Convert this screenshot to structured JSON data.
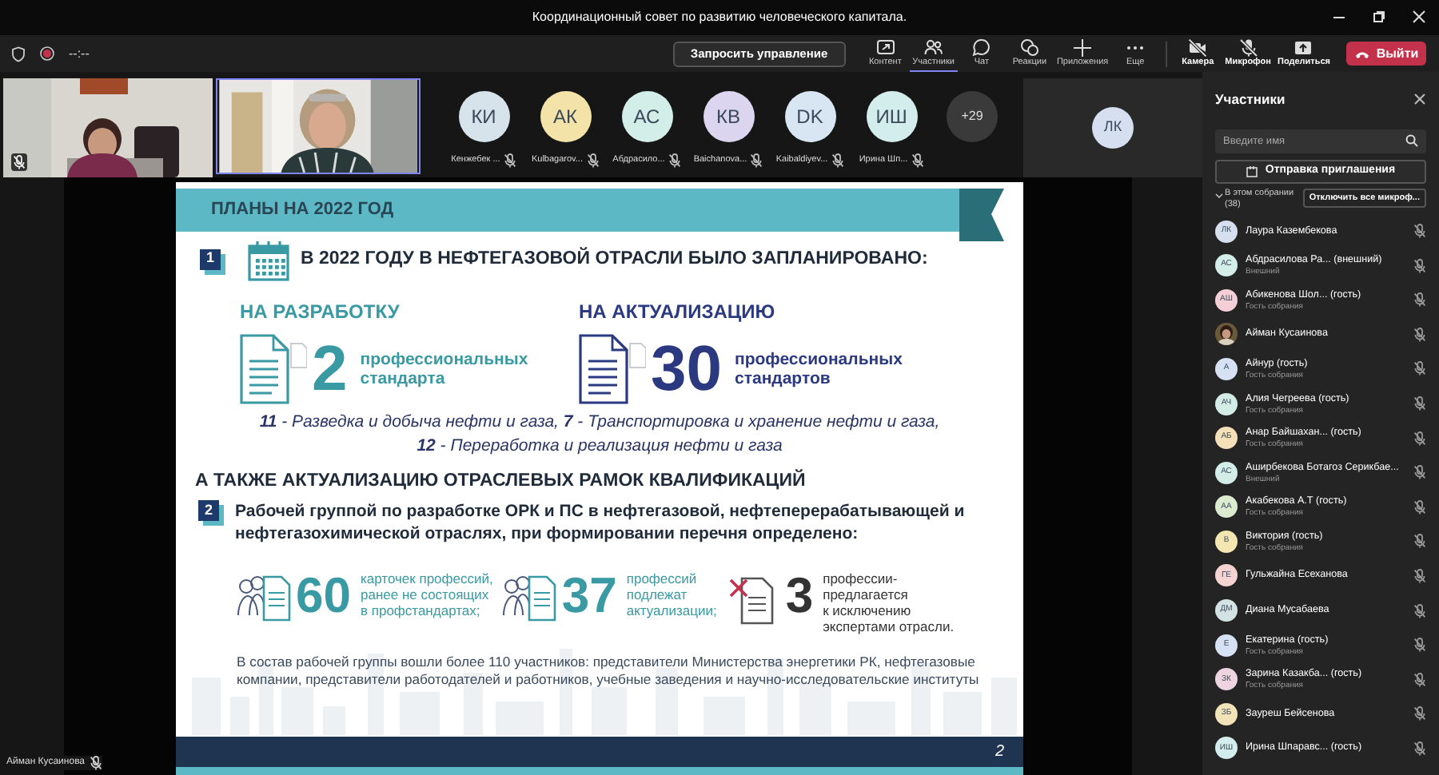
{
  "window": {
    "title": "Координационный совет по развитию человеческого капитала."
  },
  "toolbar": {
    "recording": true,
    "timer": "--:--",
    "request_control": "Запросить управление",
    "buttons": [
      {
        "label": "Контент",
        "kind": "content",
        "selected": false
      },
      {
        "label": "Участники",
        "kind": "people",
        "selected": true
      },
      {
        "label": "Чат",
        "kind": "chat",
        "selected": false
      },
      {
        "label": "Реакции",
        "kind": "reactions",
        "selected": false
      },
      {
        "label": "Приложения",
        "kind": "apps",
        "selected": false
      },
      {
        "label": "Еще",
        "kind": "more",
        "selected": false
      },
      {
        "label": "Камера",
        "kind": "camera-off",
        "selected": false
      },
      {
        "label": "Микрофон",
        "kind": "mic-off",
        "selected": false
      },
      {
        "label": "Поделиться",
        "kind": "share",
        "selected": false
      }
    ],
    "leave": "Выйти"
  },
  "video_tiles": [
    {
      "kind": "picture",
      "speaking": false,
      "muted": true
    },
    {
      "kind": "picture",
      "speaking": true,
      "muted": false
    }
  ],
  "attendees": [
    {
      "initials": "КИ",
      "name": "Кенжебек ...",
      "color": "#d6e3ea"
    },
    {
      "initials": "АК",
      "name": "Kulbagarov...",
      "color": "#f3e3a8"
    },
    {
      "initials": "АС",
      "name": "Абдрасило...",
      "color": "#d3ede8"
    },
    {
      "initials": "КВ",
      "name": "Baichanova...",
      "color": "#dcd5f0"
    },
    {
      "initials": "DK",
      "name": "Kaibaldiyev...",
      "color": "#d7e6f2"
    },
    {
      "initials": "ИШ",
      "name": "Ирина Шп...",
      "color": "#d3ecec"
    }
  ],
  "more_attendees": "+29",
  "pinned": {
    "initials": "ЛК",
    "color": "#d5dff0"
  },
  "stage_label": "Айман Кусаинова",
  "slide": {
    "header": "ПЛАНЫ НА 2022 ГОД",
    "section1": {
      "number": "1",
      "title": "В 2022 ГОДУ В НЕФТЕГАЗОВОЙ ОТРАСЛИ БЫЛО ЗАПЛАНИРОВАНО:",
      "plans": [
        {
          "kind": "teal",
          "heading": "НА РАЗРАБОТКУ",
          "number": "2",
          "text": "профессиональных стандарта"
        },
        {
          "kind": "navy",
          "heading": "НА АКТУАЛИЗАЦИЮ",
          "number": "30",
          "text": "профессиональных стандартов"
        }
      ],
      "details": [
        "**11** - Разведка и добыча нефти и газа, **7** - Транспортировка и хранение нефти и газа,",
        "**12** - Переработка и реализация нефти и газа"
      ]
    },
    "subtitle": "А ТАКЖЕ АКТУАЛИЗАЦИЮ ОТРАСЛЕВЫХ РАМОК КВАЛИФИКАЦИЙ",
    "section2": {
      "number": "2",
      "text": "Рабочей группой по разработке ОРК и ПС в нефтегазовой, нефтеперерабатывающей и нефтегазохимической отраслях, при формировании перечня определено:",
      "stats": [
        {
          "kind": "people",
          "number": "60",
          "lines": [
            "карточек профессий,",
            "ранее не состоящих",
            "в профстандартах;"
          ]
        },
        {
          "kind": "people",
          "number": "37",
          "lines": [
            "профессий",
            "подлежат",
            "актуализации;"
          ]
        },
        {
          "kind": "removed",
          "number": "3",
          "lines": [
            "профессии-",
            "предлагается",
            "к исключению",
            "экспертами отрасли."
          ]
        }
      ]
    },
    "footer": "В состав рабочей группы вошли более 110 участников: представители Министерства энергетики РК, нефтегазовые компании, представители работодателей и работников, учебные заведения и научно-исследовательские институты",
    "page": "2"
  },
  "panel": {
    "title": "Участники",
    "search_placeholder": "Введите имя",
    "invite": "Отправка приглашения",
    "section": "В этом собрании (38)",
    "expanded": true,
    "mute_all": "Отключить все микроф...",
    "people": [
      {
        "initials": "ЛК",
        "name": "Лаура Казембекова",
        "color": "#d5dff0"
      },
      {
        "initials": "АС",
        "name": "Абдрасилова Ра... (внешний)",
        "subtitle": "Внешний",
        "color": "#d3ede8"
      },
      {
        "initials": "АШ",
        "name": "Абикенова Шол... (гость)",
        "subtitle": "Гость собрания",
        "color": "#f5cfd8"
      },
      {
        "name": "Айман Кусаинова"
      },
      {
        "initials": "А",
        "name": "Айнур (гость)",
        "subtitle": "Гость собрания",
        "color": "#d6e2f3"
      },
      {
        "initials": "АЧ",
        "name": "Алия Чегреева (гость)",
        "subtitle": "Гость собрания",
        "color": "#d3ece6"
      },
      {
        "initials": "АБ",
        "name": "Анар Байшахан... (гость)",
        "subtitle": "Гость собрания",
        "color": "#f3e0b8"
      },
      {
        "initials": "АС",
        "name": "Аширбекова Ботагоз Серикбае...",
        "subtitle": "Внешний",
        "color": "#d3ede8"
      },
      {
        "initials": "АА",
        "name": "Акабекова А.Т (гость)",
        "subtitle": "Гость собрания",
        "color": "#dcebd0"
      },
      {
        "initials": "В",
        "name": "Виктория (гость)",
        "subtitle": "Гость собрания",
        "color": "#f3e6b0"
      },
      {
        "initials": "ГЕ",
        "name": "Гульжайна Есеханова",
        "color": "#f6d3d3"
      },
      {
        "initials": "ДМ",
        "name": "Диана Мусабаева",
        "color": "#d3e3e3"
      },
      {
        "initials": "Е",
        "name": "Екатерина (гость)",
        "subtitle": "Гость собрания",
        "color": "#d6e2f3"
      },
      {
        "initials": "ЗК",
        "name": "Зарина Казакба... (гость)",
        "subtitle": "Гость собрания",
        "color": "#eed3e0"
      },
      {
        "initials": "ЗБ",
        "name": "Зауреш Бейсенова",
        "color": "#f3e3b8"
      },
      {
        "initials": "ИШ",
        "name": "Ирина Шпаравс... (гость)",
        "color": "#d3ecec"
      }
    ]
  }
}
